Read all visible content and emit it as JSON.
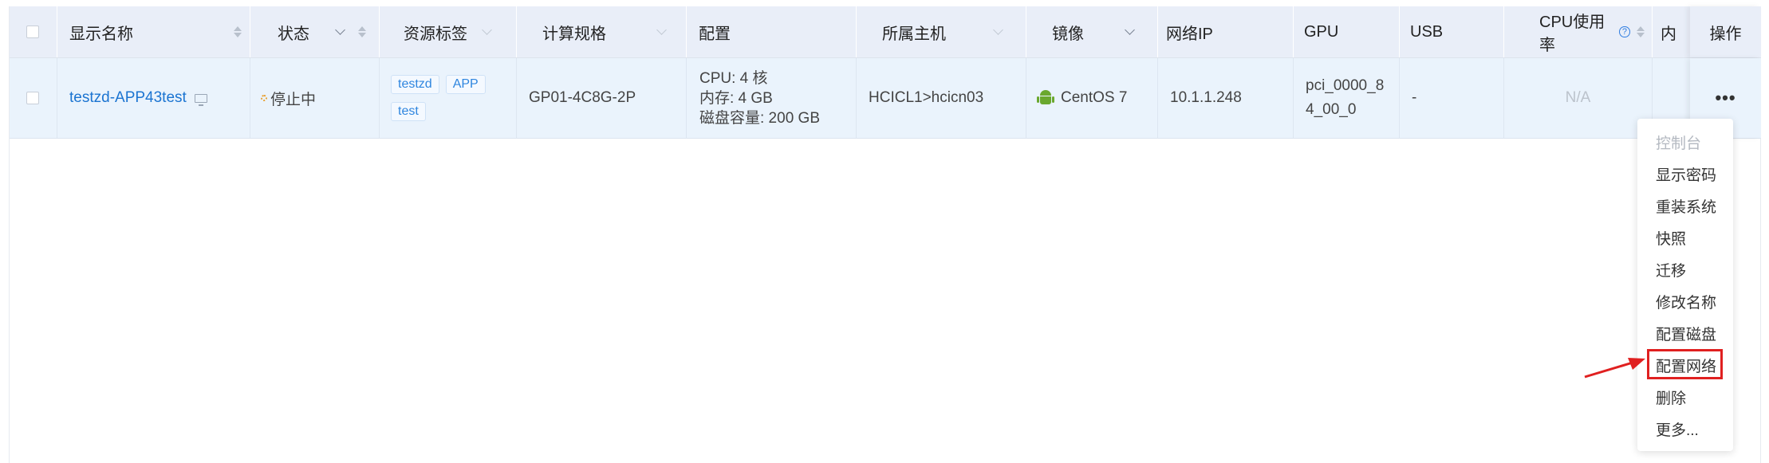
{
  "table": {
    "columns": {
      "name": "显示名称",
      "status": "状态",
      "tags": "资源标签",
      "spec": "计算规格",
      "config": "配置",
      "host": "所属主机",
      "image": "镜像",
      "ip": "网络IP",
      "gpu": "GPU",
      "usb": "USB",
      "cpu": "CPU使用率",
      "truncated": "内",
      "actions": "操作"
    },
    "rows": [
      {
        "name": "testzd-APP43test",
        "status": "停止中",
        "tags": [
          "testzd",
          "APP",
          "test"
        ],
        "spec": "GP01-4C8G-2P",
        "config": [
          "CPU: 4 核",
          "内存: 4 GB",
          "磁盘容量: 200 GB"
        ],
        "host": "HCICL1>hcicn03",
        "image": "CentOS 7",
        "ip": "10.1.1.248",
        "gpu": [
          "pci_0000_8",
          "4_00_0"
        ],
        "usb": "-",
        "cpu": "N/A",
        "actions": "•••"
      }
    ]
  },
  "dropdown": {
    "items": [
      {
        "label": "控制台",
        "disabled": true
      },
      {
        "label": "显示密码",
        "disabled": false
      },
      {
        "label": "重装系统",
        "disabled": false
      },
      {
        "label": "快照",
        "disabled": false
      },
      {
        "label": "迁移",
        "disabled": false
      },
      {
        "label": "修改名称",
        "disabled": false
      },
      {
        "label": "配置磁盘",
        "disabled": false
      },
      {
        "label": "配置网络",
        "disabled": false,
        "highlighted": true
      },
      {
        "label": "删除",
        "disabled": false
      },
      {
        "label": "更多...",
        "disabled": false
      }
    ]
  },
  "colors": {
    "link": "#1b74d1",
    "header_bg": "#e9eef8",
    "row_bg": "#eaf3fc",
    "highlight": "#e02020"
  }
}
